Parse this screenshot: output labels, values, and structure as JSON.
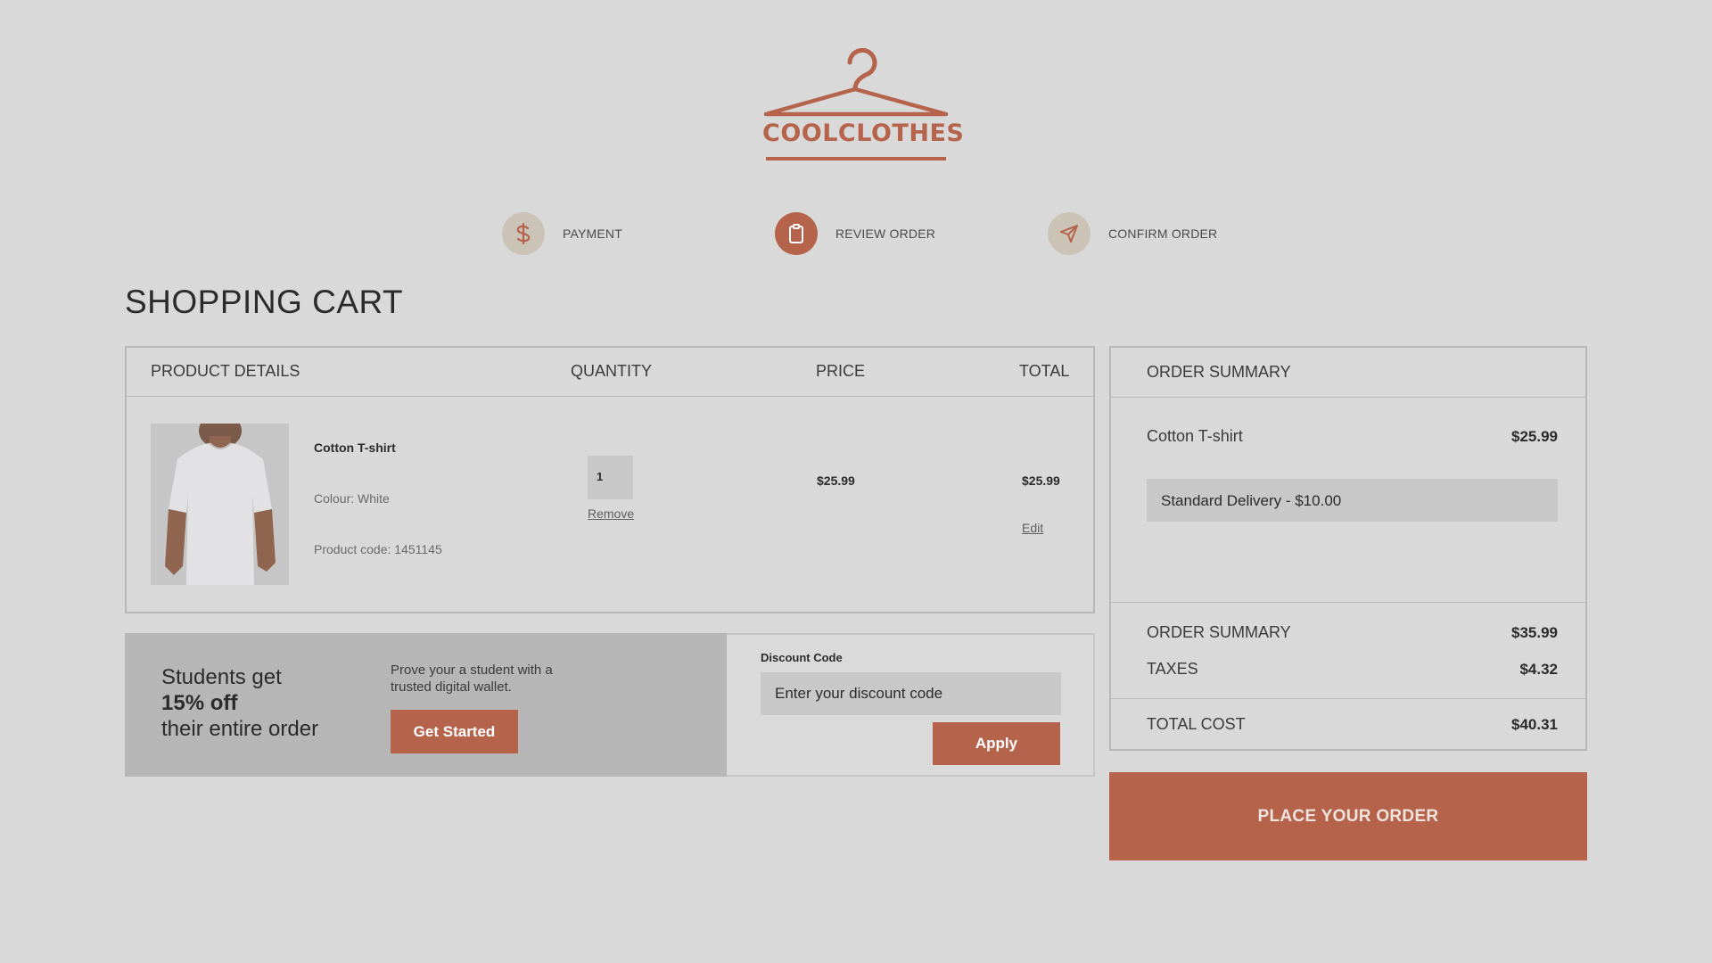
{
  "brand": {
    "name": "COOLCLOTHES",
    "color": "#b5634b"
  },
  "steps": [
    {
      "label": "PAYMENT",
      "icon": "dollar-icon",
      "active": false
    },
    {
      "label": "REVIEW ORDER",
      "icon": "clipboard-icon",
      "active": true
    },
    {
      "label": "CONFIRM ORDER",
      "icon": "send-icon",
      "active": false
    }
  ],
  "page": {
    "title": "SHOPPING CART"
  },
  "cart": {
    "headers": {
      "product": "PRODUCT DETAILS",
      "quantity": "QUANTITY",
      "price": "PRICE",
      "total": "TOTAL"
    },
    "item": {
      "name": "Cotton T-shirt",
      "colour": "Colour: White",
      "code": "Product code: 1451145",
      "quantity": "1",
      "remove_label": "Remove",
      "price": "$25.99",
      "total": "$25.99",
      "edit_label": "Edit"
    }
  },
  "promo": {
    "line1": "Students get",
    "line2": "15% off",
    "line3": "their entire order",
    "description": "Prove your a student with a trusted digital wallet.",
    "button_label": "Get Started"
  },
  "discount": {
    "label": "Discount Code",
    "placeholder": "Enter your discount code",
    "value": "",
    "apply_label": "Apply"
  },
  "summary": {
    "title": "ORDER SUMMARY",
    "item_name": "Cotton T-shirt",
    "item_price": "$25.99",
    "delivery": "Standard Delivery - $10.00",
    "subtotal_label": "ORDER SUMMARY",
    "subtotal_value": "$35.99",
    "taxes_label": "TAXES",
    "taxes_value": "$4.32",
    "total_label": "TOTAL COST",
    "total_value": "$40.31"
  },
  "place_order_label": "PLACE YOUR ORDER"
}
